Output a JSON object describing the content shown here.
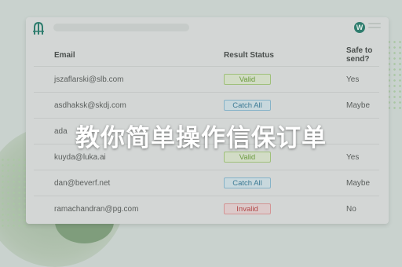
{
  "app": {
    "avatar_initial": "W",
    "logo_icon": "logo-icon",
    "accent_color": "#2f7d6e"
  },
  "table": {
    "headers": [
      "Email",
      "Result Status",
      "Safe to send?"
    ],
    "rows": [
      {
        "email": "jszaflarski@slb.com",
        "status": "Valid",
        "status_type": "valid",
        "safe": "Yes"
      },
      {
        "email": "asdhaksk@skdj.com",
        "status": "Catch All",
        "status_type": "catch",
        "safe": "Maybe"
      },
      {
        "email": "ada",
        "status": "",
        "status_type": "",
        "safe": ""
      },
      {
        "email": "kuyda@luka.ai",
        "status": "Valid",
        "status_type": "valid",
        "safe": "Yes"
      },
      {
        "email": "dan@beverf.net",
        "status": "Catch All",
        "status_type": "catch",
        "safe": "Maybe"
      },
      {
        "email": "ramachandran@pg.com",
        "status": "Invalid",
        "status_type": "invalid",
        "safe": "No"
      }
    ]
  },
  "overlay": {
    "title": "教你简单操作信保订单"
  },
  "status_colors": {
    "valid": "#6a9a3c",
    "catch": "#3c7a94",
    "invalid": "#b24a4a"
  }
}
